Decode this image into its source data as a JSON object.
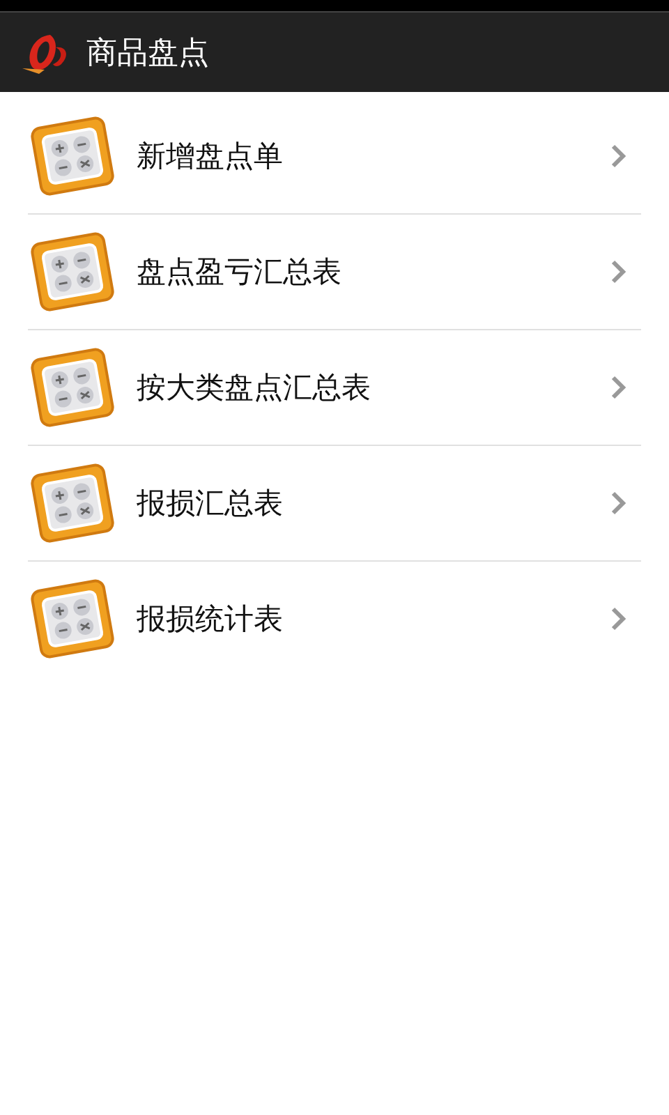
{
  "app_bar": {
    "title": "商品盘点"
  },
  "menu": [
    {
      "label": "新增盘点单"
    },
    {
      "label": "盘点盈亏汇总表"
    },
    {
      "label": "按大类盘点汇总表"
    },
    {
      "label": "报损汇总表"
    },
    {
      "label": "报损统计表"
    }
  ]
}
